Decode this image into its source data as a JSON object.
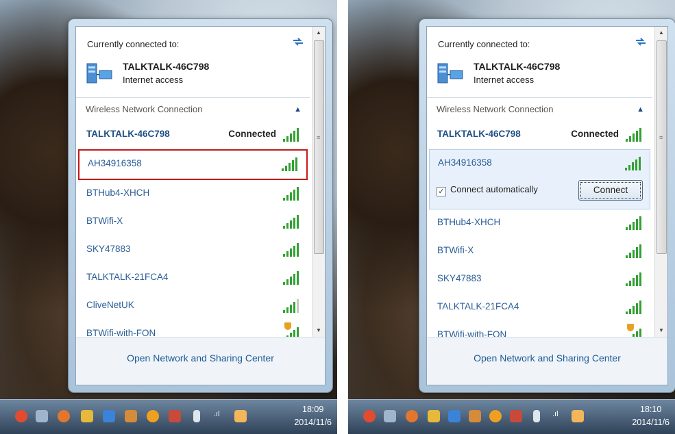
{
  "screens": [
    {
      "current_label": "Currently connected to:",
      "current_network": "TALKTALK-46C798",
      "current_status": "Internet access",
      "section_header": "Wireless Network Connection",
      "networks": [
        {
          "name": "TALKTALK-46C798",
          "status": "Connected"
        },
        {
          "name": "AH34916358"
        },
        {
          "name": "BTHub4-XHCH"
        },
        {
          "name": "BTWifi-X"
        },
        {
          "name": "SKY47883"
        },
        {
          "name": "TALKTALK-21FCA4"
        },
        {
          "name": "CliveNetUK"
        },
        {
          "name": "BTWifi-with-FON"
        }
      ],
      "footer_link": "Open Network and Sharing Center",
      "clock_time": "18:09",
      "clock_date": "2014/11/6"
    },
    {
      "current_label": "Currently connected to:",
      "current_network": "TALKTALK-46C798",
      "current_status": "Internet access",
      "section_header": "Wireless Network Connection",
      "networks": [
        {
          "name": "TALKTALK-46C798",
          "status": "Connected"
        },
        {
          "name": "AH34916358",
          "connect_automatically_label": "Connect automatically",
          "connect_automatically_checked": true,
          "connect_button": "Connect"
        },
        {
          "name": "BTHub4-XHCH"
        },
        {
          "name": "BTWifi-X"
        },
        {
          "name": "SKY47883"
        },
        {
          "name": "TALKTALK-21FCA4"
        },
        {
          "name": "BTWifi-with-FON"
        }
      ],
      "footer_link": "Open Network and Sharing Center",
      "clock_time": "18:10",
      "clock_date": "2014/11/6"
    }
  ],
  "colors": {
    "link_blue": "#2a5d97",
    "highlight_red": "#c21b1b",
    "signal_green": "#31a132"
  },
  "icons": {
    "current_network": "network-computer-icon",
    "refresh": "refresh-arrows-icon",
    "collapse": "chevron-up-icon",
    "signal": "wifi-signal-bars-icon",
    "secured_shield": "security-shield-icon"
  }
}
